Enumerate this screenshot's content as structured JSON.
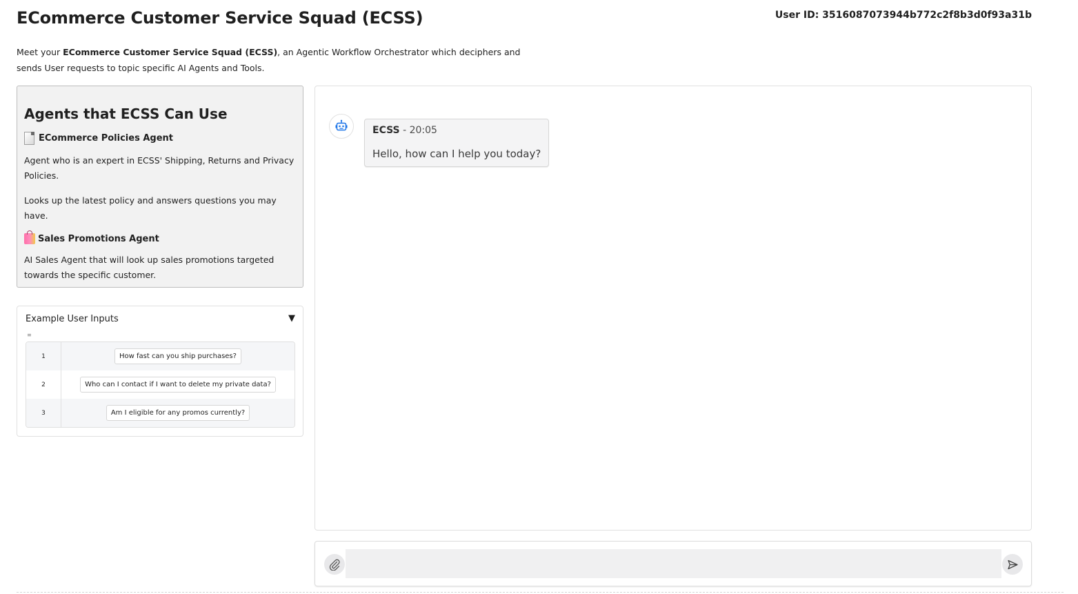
{
  "header": {
    "title": "ECommerce Customer Service Squad (ECSS)",
    "user_id": "User ID: 3516087073944b772c2f8b3d0f93a31b"
  },
  "intro": {
    "prefix": "Meet your ",
    "bold": "ECommerce Customer Service Squad (ECSS)",
    "suffix": ", an Agentic Workflow Orchestrator which deciphers and sends User requests to topic specific AI Agents and Tools."
  },
  "agents_panel": {
    "title": "Agents that ECSS Can Use",
    "agents": [
      {
        "icon": "document-icon",
        "name": "ECommerce Policies Agent",
        "descriptions": [
          "Agent who is an expert in ECSS' Shipping, Returns and Privacy Policies.",
          "Looks up the latest policy and answers questions you may have."
        ]
      },
      {
        "icon": "shopping-bags-icon",
        "name": "Sales Promotions Agent",
        "descriptions": [
          "AI Sales Agent that will look up sales promotions targeted towards the specific customer."
        ]
      }
    ]
  },
  "examples": {
    "header": "Example User Inputs",
    "toggle": "▼",
    "menu_glyph": "≡",
    "rows": [
      {
        "index": "1",
        "text": "How fast can you ship purchases?"
      },
      {
        "index": "2",
        "text": "Who can I contact if I want to delete my private data?"
      },
      {
        "index": "3",
        "text": "Am I eligible for any promos currently?"
      }
    ]
  },
  "chat": {
    "messages": [
      {
        "sender": "ECSS",
        "time": " - 20:05",
        "text": "Hello, how can I help you today?"
      }
    ]
  },
  "input_bar": {
    "value": "",
    "placeholder": ""
  },
  "colors": {
    "accent_bot": "#1a73e8",
    "panel_bg": "#f2f2f2",
    "border": "#e0e0e0"
  }
}
